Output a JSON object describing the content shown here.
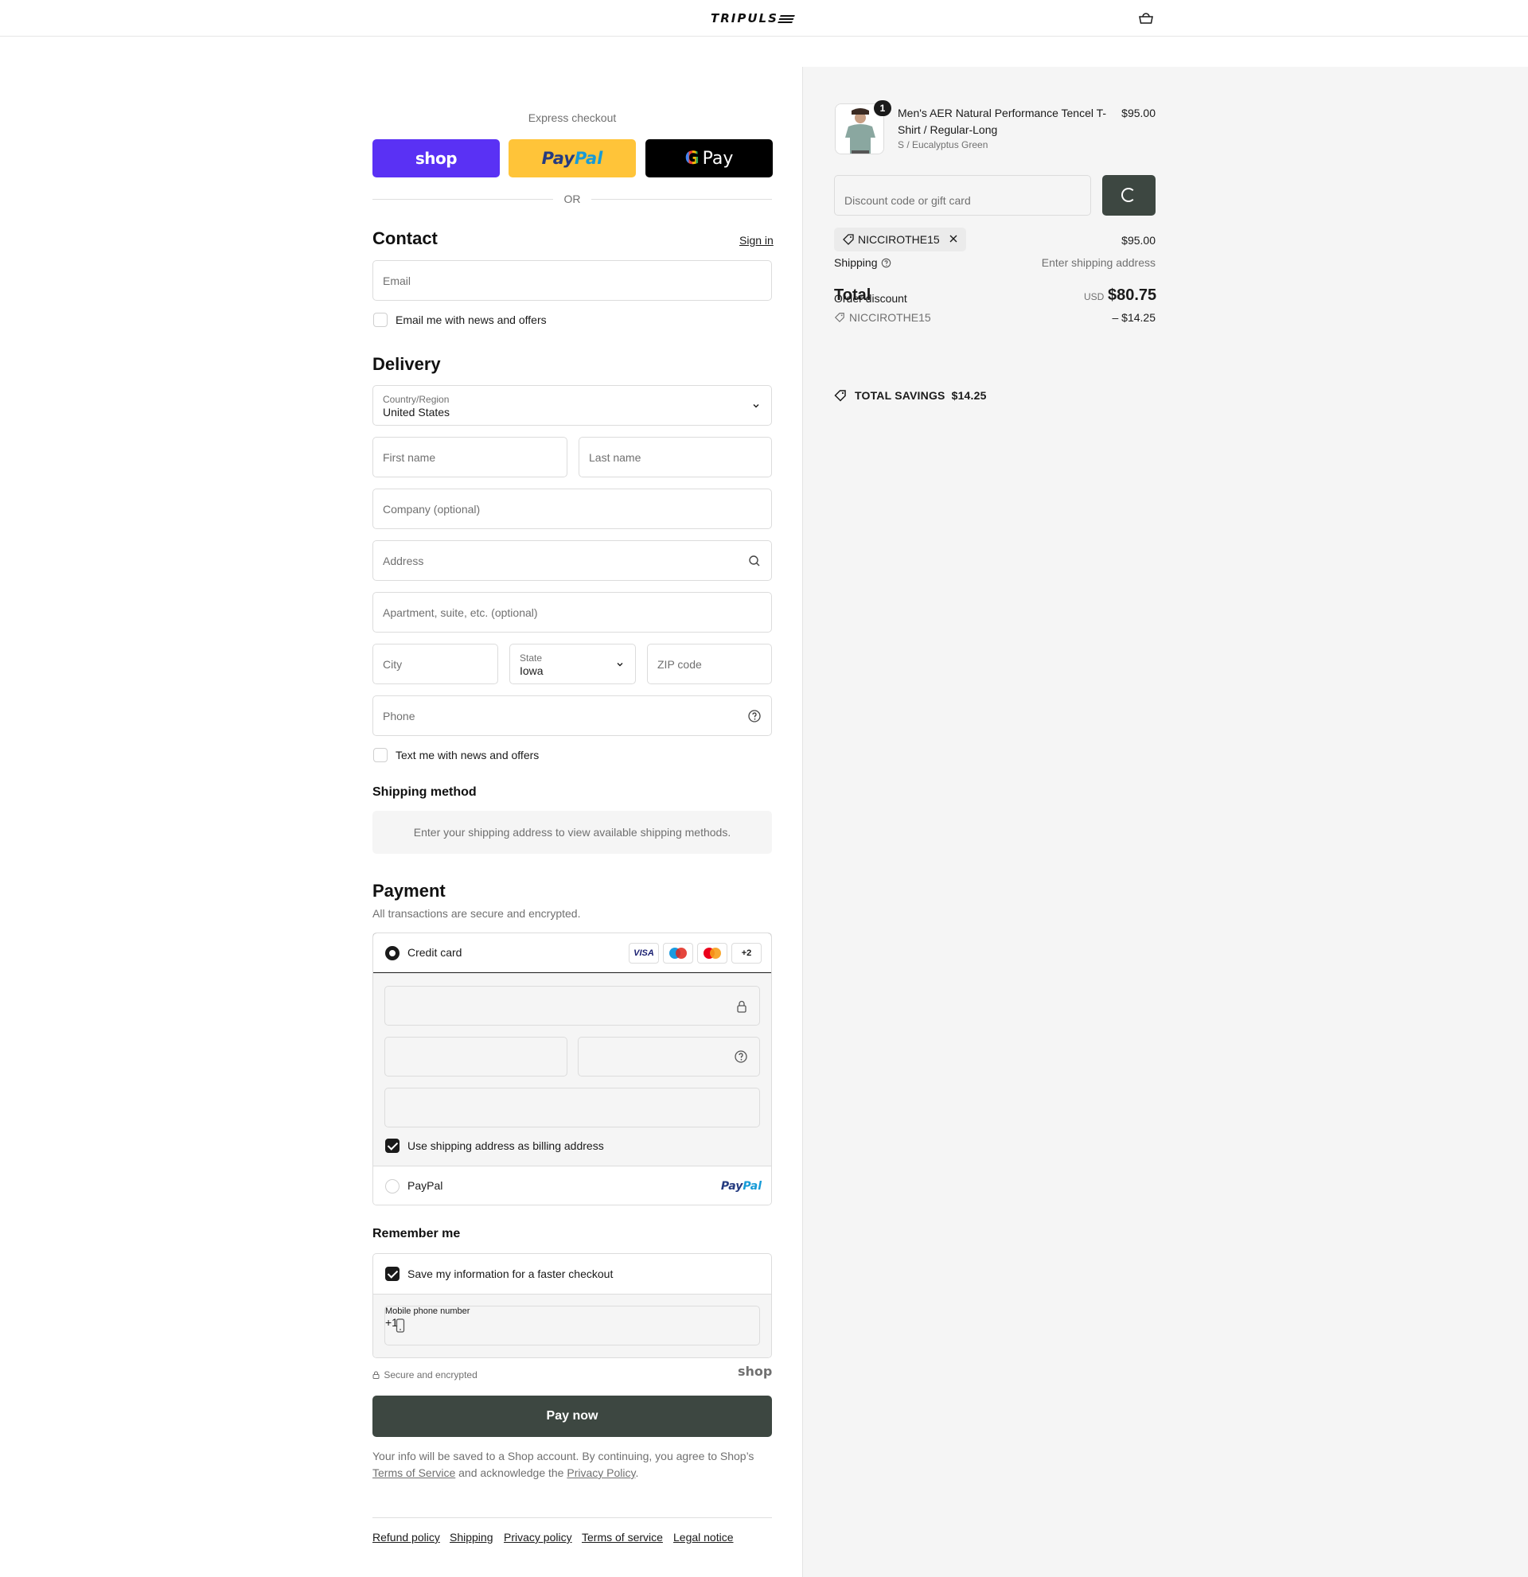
{
  "header": {
    "logo": "TRIPULS"
  },
  "express": {
    "label": "Express checkout",
    "shop_label": "shop",
    "paypal_label_a": "Pay",
    "paypal_label_b": "Pal",
    "gpay_g": "G",
    "gpay_label": "Pay",
    "or_label": "OR"
  },
  "contact": {
    "title": "Contact",
    "sign_in": "Sign in",
    "email_placeholder": "Email",
    "news_label": "Email me with news and offers"
  },
  "delivery": {
    "title": "Delivery",
    "country_label": "Country/Region",
    "country_value": "United States",
    "first_name_placeholder": "First name",
    "last_name_placeholder": "Last name",
    "company_placeholder": "Company (optional)",
    "address_placeholder": "Address",
    "apartment_placeholder": "Apartment, suite, etc. (optional)",
    "city_placeholder": "City",
    "state_label": "State",
    "state_value": "Iowa",
    "zip_placeholder": "ZIP code",
    "phone_placeholder": "Phone",
    "text_label": "Text me with news and offers"
  },
  "shipping_method": {
    "title": "Shipping method",
    "message": "Enter your shipping address to view available shipping methods."
  },
  "payment": {
    "title": "Payment",
    "subtitle": "All transactions are secure and encrypted.",
    "credit_card_label": "Credit card",
    "card_badges": [
      "VISA",
      "Maestro",
      "Mastercard",
      "+2"
    ],
    "plus_label": "+2",
    "visa_label": "VISA",
    "billing_label": "Use shipping address as billing address",
    "paypal_option_label": "PayPal",
    "paypal_logo_a": "Pay",
    "paypal_logo_b": "Pal"
  },
  "remember": {
    "title": "Remember me",
    "save_label": "Save my information for a faster checkout",
    "mobile_label": "Mobile phone number",
    "mobile_value": "+1",
    "secure_label": "Secure and encrypted",
    "shop_label": "shop"
  },
  "pay_button": "Pay now",
  "legal": {
    "text_1": "Your info will be saved to a Shop account. By continuing, you agree to Shop’s ",
    "terms": "Terms of Service",
    "text_2": " and acknowledge the ",
    "privacy": "Privacy Policy",
    "text_3": "."
  },
  "footer_links": [
    "Refund policy",
    "Shipping",
    "Privacy policy",
    "Terms of service",
    "Legal notice"
  ],
  "summary": {
    "product": {
      "name": "Men's AER Natural Performance Tencel T-Shirt / Regular-Long",
      "variant": "S / Eucalyptus Green",
      "price": "$95.00",
      "quantity": "1"
    },
    "discount_placeholder": "Discount code or gift card",
    "applied_code": "NICCIROTHE15",
    "subtotal": "$95.00",
    "shipping_label": "Shipping",
    "shipping_value": "Enter shipping address",
    "order_discount_label": "Order discount",
    "discount_code": "NICCIROTHE15",
    "discount_amount": "– $14.25",
    "total_label": "Total",
    "currency": "USD",
    "total": "$80.75",
    "savings_label": "TOTAL SAVINGS",
    "savings_value": "$14.25"
  },
  "colors": {
    "shop_purple": "#5a31f4",
    "paypal_yellow": "#ffc439",
    "pay_button": "#3d4741"
  }
}
